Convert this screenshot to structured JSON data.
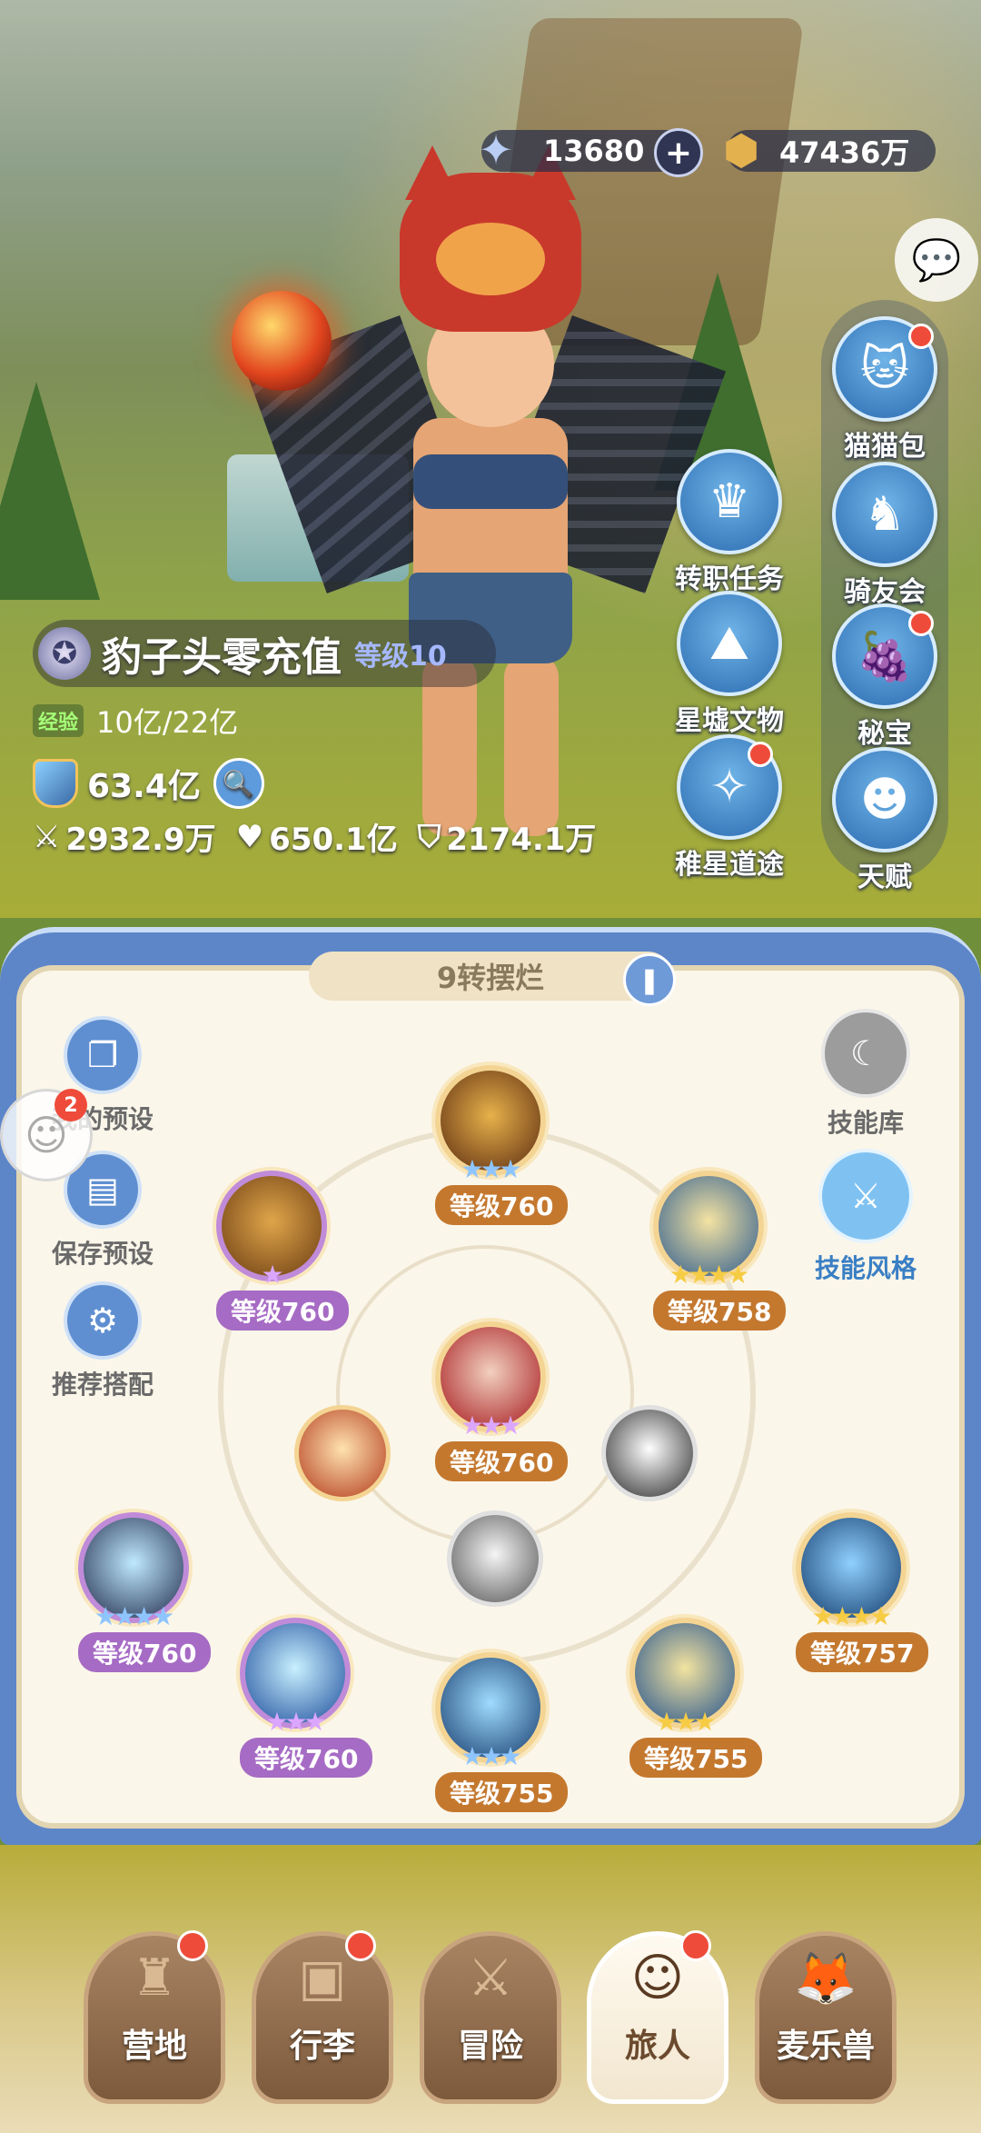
{
  "currency": {
    "gems": "13680",
    "gems_icon": "star-crystal-icon",
    "coins": "47436万",
    "coins_icon": "coin-icon",
    "plus": "+"
  },
  "side_buttons": [
    {
      "label": "猫猫包",
      "icon": "cat-bag-icon",
      "glyph": "🐱",
      "dot": true
    },
    {
      "label": "骑友会",
      "icon": "horse-icon",
      "glyph": "♞",
      "dot": false
    },
    {
      "label": "秘宝",
      "icon": "treasure-icon",
      "glyph": "🍇",
      "dot": true
    },
    {
      "label": "天赋",
      "icon": "talent-head-icon",
      "glyph": "☻",
      "dot": false
    }
  ],
  "mid_buttons": [
    {
      "label": "转职任务",
      "icon": "crown-hat-icon",
      "glyph": "♛",
      "dot": false
    },
    {
      "label": "星墟文物",
      "icon": "mountain-relic-icon",
      "glyph": "⛰",
      "dot": false
    },
    {
      "label": "稚星道途",
      "icon": "cat-path-icon",
      "glyph": "✧",
      "dot": true
    }
  ],
  "player": {
    "name": "豹子头零充值",
    "level": "等级10",
    "exp_tag": "经验",
    "exp": "10亿/22亿",
    "power": "63.4亿",
    "attack": "2932.9万",
    "hp": "650.1亿",
    "defense": "2174.1万"
  },
  "preset": {
    "title": "9转摆烂"
  },
  "left_buttons": [
    {
      "label": "我的预设",
      "icon": "cards-icon",
      "glyph": "❐"
    },
    {
      "label": "保存预设",
      "icon": "save-disk-icon",
      "glyph": "▤"
    },
    {
      "label": "推荐搭配",
      "icon": "recommend-icon",
      "glyph": "⚙"
    }
  ],
  "right_buttons": [
    {
      "label": "技能库",
      "icon": "skill-library-icon",
      "glyph": "☾"
    },
    {
      "label": "技能风格",
      "icon": "sword-style-icon",
      "glyph": "⚔"
    }
  ],
  "skills": [
    {
      "level": "等级760",
      "stars": 3,
      "star_color": "blue",
      "tag": "orange",
      "colors": [
        "#e7b14a",
        "#5a2a10"
      ]
    },
    {
      "level": "等级760",
      "stars": 1,
      "star_color": "purple",
      "tag": "purple",
      "colors": [
        "#e0a54a",
        "#6a3c12"
      ]
    },
    {
      "level": "等级758",
      "stars": 4,
      "star_color": "gold",
      "tag": "orange",
      "colors": [
        "#f4e3a2",
        "#2b5a8f"
      ]
    },
    {
      "level": "等级760",
      "stars": 3,
      "star_color": "purple",
      "tag": "orange",
      "colors": [
        "#f2d0c0",
        "#a5161a"
      ]
    },
    {
      "level": "等级760",
      "stars": 4,
      "star_color": "blue",
      "tag": "purple",
      "colors": [
        "#bfe9ff",
        "#1f2a4a"
      ]
    },
    {
      "level": "等级757",
      "stars": 4,
      "star_color": "gold",
      "tag": "orange",
      "colors": [
        "#8fd0ff",
        "#123a6a"
      ]
    },
    {
      "level": "等级760",
      "stars": 3,
      "star_color": "purple",
      "tag": "purple",
      "colors": [
        "#c9f0ff",
        "#1a4b9a"
      ]
    },
    {
      "level": "等级755",
      "stars": 3,
      "star_color": "blue",
      "tag": "orange",
      "colors": [
        "#9fdcff",
        "#153a6b"
      ]
    },
    {
      "level": "等级755",
      "stars": 3,
      "star_color": "gold",
      "tag": "orange",
      "colors": [
        "#f3e3a0",
        "#1e4f8d"
      ]
    }
  ],
  "notification_badge": "2",
  "nav": [
    {
      "label": "营地",
      "icon": "castle-icon",
      "glyph": "♜",
      "dot": true,
      "active": false
    },
    {
      "label": "行李",
      "icon": "backpack-icon",
      "glyph": "▣",
      "dot": true,
      "active": false
    },
    {
      "label": "冒险",
      "icon": "crossed-swords-icon",
      "glyph": "⚔",
      "dot": false,
      "active": false
    },
    {
      "label": "旅人",
      "icon": "traveler-portrait-icon",
      "glyph": "☺",
      "dot": true,
      "active": true
    },
    {
      "label": "麦乐兽",
      "icon": "fox-pet-icon",
      "glyph": "🦊",
      "dot": false,
      "active": false
    }
  ]
}
